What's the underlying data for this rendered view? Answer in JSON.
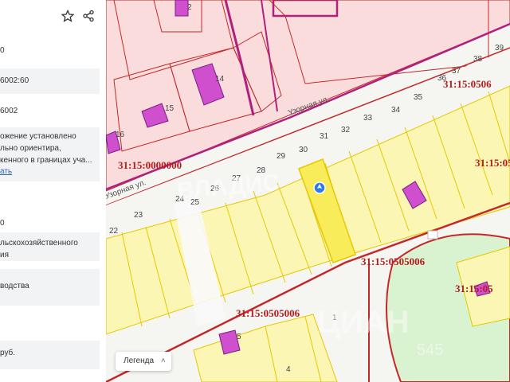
{
  "toolbar": {
    "star_icon": "star-icon",
    "share_icon": "share-icon"
  },
  "panel": {
    "rows": [
      "0",
      "6002:60",
      "6002",
      "ожение установлено",
      "льно ориентира,",
      "кенного в границах уча...",
      "ать",
      "0",
      "льскохозяйственного",
      "ия",
      "водства",
      "руб."
    ]
  },
  "map": {
    "street_labels": [
      "Узорная ул.",
      "Узорная ул."
    ],
    "cadastral_labels": [
      "31:15:0000000",
      "31:15:0506",
      "31:15:05",
      "31:15:0505006",
      "31:15:0505006",
      "31:15:05"
    ],
    "plot_numbers": [
      "2",
      "14",
      "15",
      "16",
      "22",
      "23",
      "24",
      "25",
      "26",
      "27",
      "28",
      "29",
      "30",
      "31",
      "32",
      "33",
      "34",
      "35",
      "36",
      "37",
      "38",
      "39",
      "4",
      "5",
      "1"
    ],
    "watermark": "ЦИАН",
    "watermark_digits": "545",
    "marker_icon": "map-pin-icon"
  },
  "legend": {
    "label": "Легенда",
    "chevron": "˄"
  },
  "colors": {
    "plot_fill": "#fbf6b4",
    "plot_border": "#e6c800",
    "building": "#d04fcf",
    "magenta_line": "#b0207d",
    "red_line": "#c4282a",
    "green_area": "#d9f2cf"
  }
}
